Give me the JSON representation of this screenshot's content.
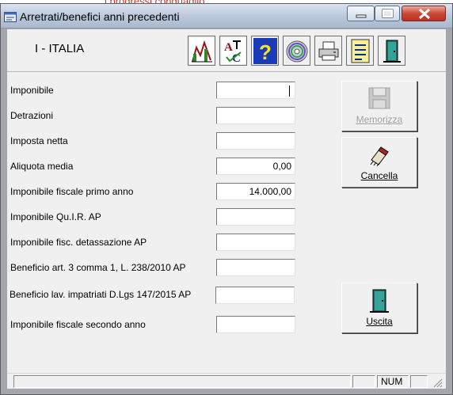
{
  "background_app": {
    "partial_text": "i progressi conguaglio"
  },
  "window": {
    "title": "Arretrati/benefici anni precedenti"
  },
  "toolbar": {
    "country": "I - ITALIA",
    "buttons": [
      "chart-icon",
      "spellcheck-icon",
      "help-icon",
      "disc-icon",
      "printer-icon",
      "notes-icon",
      "exit-door-icon"
    ]
  },
  "form": {
    "fields": [
      {
        "label": "Imponibile",
        "value": ""
      },
      {
        "label": "Detrazioni",
        "value": ""
      },
      {
        "label": "Imposta netta",
        "value": ""
      },
      {
        "label": "Aliquota media",
        "value": "0,00"
      },
      {
        "label": "Imponibile fiscale primo anno",
        "value": "14.000,00"
      },
      {
        "label": "Imponibile Qu.I.R. AP",
        "value": ""
      },
      {
        "label": "Imponibile fisc. detassazione AP",
        "value": ""
      },
      {
        "label": "Beneficio art. 3 comma 1, L. 238/2010 AP",
        "value": ""
      },
      {
        "label": "Beneficio lav. impatriati D.Lgs 147/2015  AP",
        "value": ""
      },
      {
        "label": "Imponibile fiscale secondo anno",
        "value": ""
      }
    ]
  },
  "actions": {
    "memorizza": "Memorizza",
    "cancella": "Cancella",
    "uscita": "Uscita"
  },
  "status": {
    "num": "NUM"
  },
  "colors": {
    "title_gradient": "#bac7da",
    "close_red": "#cc4a35",
    "client_bg": "#f0f0f0"
  }
}
